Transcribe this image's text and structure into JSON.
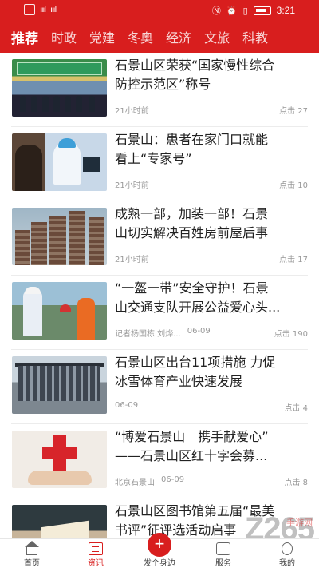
{
  "status_bar": {
    "time": "3:21",
    "signal": "ıııl"
  },
  "tabs": [
    "推荐",
    "时政",
    "党建",
    "冬奥",
    "经济",
    "文旅",
    "科教"
  ],
  "articles": [
    {
      "title_lines": [
        "石景山区荣获“国家慢性综合",
        "防控示范区”称号"
      ],
      "source": "",
      "time": "21小时前",
      "clicks": "点击 27"
    },
    {
      "title_lines": [
        "石景山：患者在家门口就能",
        "看上“专家号”"
      ],
      "source": "",
      "time": "21小时前",
      "clicks": "点击 10"
    },
    {
      "title_lines": [
        "成熟一部，加装一部！石景",
        "山切实解决百姓房前屋后事"
      ],
      "source": "",
      "time": "21小时前",
      "clicks": "点击 17"
    },
    {
      "title_lines": [
        "“一盔一带”安全守护！石景",
        "山交通支队开展公益爱心头..."
      ],
      "source": "记者杨国栋 刘烨...",
      "time": "06-09",
      "clicks": "点击 190"
    },
    {
      "title_lines": [
        "石景山区出台11项措施 力促",
        "冰雪体育产业快速发展"
      ],
      "source": "",
      "time": "06-09",
      "clicks": "点击 4"
    },
    {
      "title_lines": [
        "“博爱石景山　携手献爱心”",
        "——石景山区红十字会募..."
      ],
      "source": "北京石景山",
      "time": "06-09",
      "clicks": "点击 8"
    },
    {
      "title_lines": [
        "石景山区图书馆第五届“最美",
        "书评”征评选活动启事"
      ],
      "source": "",
      "time": "",
      "clicks": ""
    }
  ],
  "bottom_nav": [
    {
      "label": "首页",
      "icon": "home-icon"
    },
    {
      "label": "资讯",
      "icon": "news-icon"
    },
    {
      "label": "发个身边",
      "icon": "plus-icon",
      "symbol": "+"
    },
    {
      "label": "服务",
      "icon": "service-icon"
    },
    {
      "label": "我的",
      "icon": "profile-icon"
    }
  ],
  "watermark": {
    "text": "Z265",
    "sub": "手游网"
  },
  "colors": {
    "accent": "#d81e1e",
    "text": "#222222",
    "meta": "#999999"
  }
}
